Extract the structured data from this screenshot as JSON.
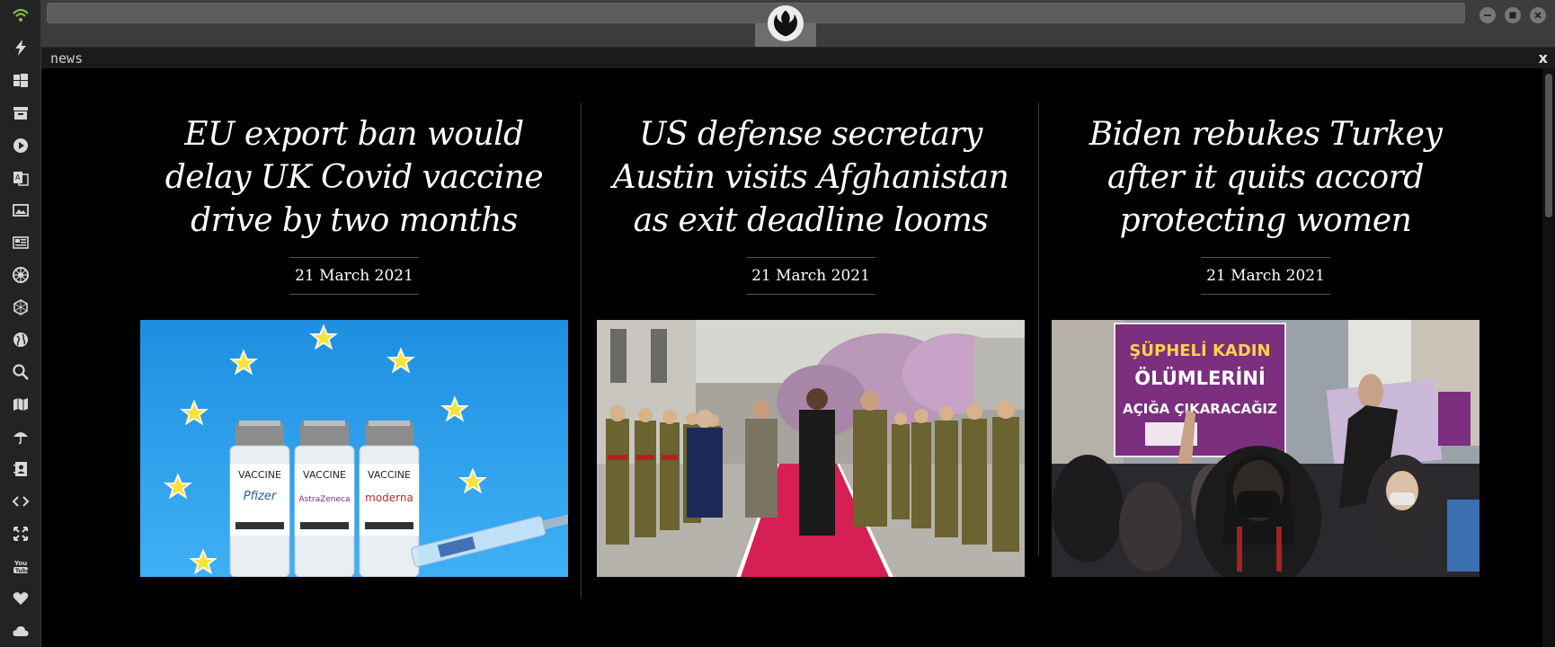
{
  "window": {
    "tab_title": "news",
    "close_label": "x"
  },
  "sidebar": {
    "icons": [
      "wifi-icon",
      "lightning-icon",
      "windows-icon",
      "archive-icon",
      "play-icon",
      "translate-icon",
      "image-icon",
      "newspaper-icon",
      "empire-icon",
      "hexagon-icon",
      "globe-icon",
      "search-icon",
      "map-icon",
      "umbrella-icon",
      "contact-icon",
      "code-icon",
      "expand-icon",
      "youtube-icon",
      "heart-icon",
      "cloud-icon"
    ]
  },
  "articles": [
    {
      "headline": "EU export ban would delay UK Covid vaccine drive by two months",
      "date": "21 March 2021",
      "image": {
        "labels": [
          "VACCINE",
          "Pfizer",
          "VACCINE",
          "AstraZeneca",
          "VACCINE",
          "moderna"
        ]
      }
    },
    {
      "headline": "US defense secretary Austin visits Afghanistan as exit deadline looms",
      "date": "21 March 2021",
      "image": {
        "labels": []
      }
    },
    {
      "headline": "Biden rebukes Turkey after it quits accord protecting women",
      "date": "21 March 2021",
      "image": {
        "labels": [
          "ŞÜPHELİ KADIN",
          "ÖLÜMLERİNİ",
          "AÇIĞA ÇIKARACAĞIZ"
        ]
      }
    }
  ],
  "colors": {
    "wifi": "#7cc24a",
    "accent_blue": "#2a9be8",
    "protest_purple": "#7b2f7e"
  }
}
